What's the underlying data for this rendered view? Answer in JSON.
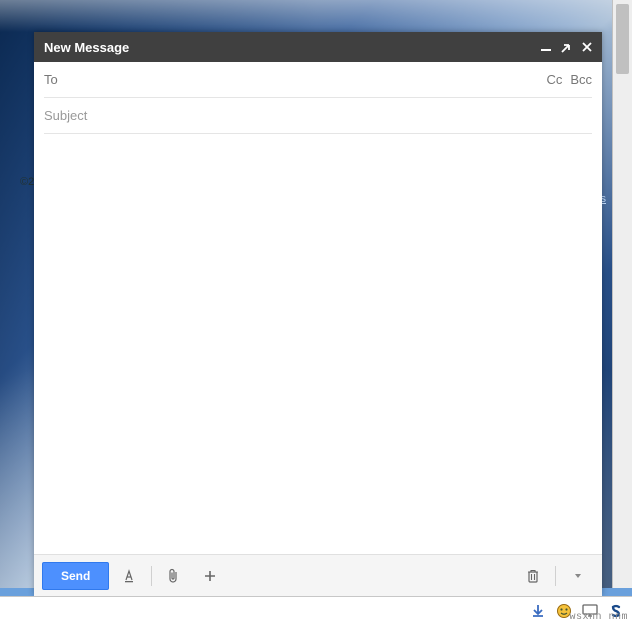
{
  "window": {
    "title": "New Message",
    "controls": {
      "minimize": "minimize-icon",
      "popout": "popout-icon",
      "close": "close-icon"
    }
  },
  "fields": {
    "to": {
      "label": "To",
      "value": ""
    },
    "cc": {
      "label": "Cc"
    },
    "bcc": {
      "label": "Bcc"
    },
    "subject": {
      "placeholder": "Subject",
      "value": ""
    }
  },
  "body": {
    "value": ""
  },
  "toolbar": {
    "send_label": "Send",
    "format_icon": "format-text-icon",
    "attach_icon": "attach-icon",
    "insert_icon": "plus-icon",
    "discard_icon": "trash-icon",
    "more_icon": "chevron-down-icon"
  },
  "background": {
    "copyright": "©2",
    "right_link_fragment": "s"
  },
  "watermark": "wsxnn nnm",
  "colors": {
    "accent": "#4d90fe",
    "titlebar_bg": "#404040"
  }
}
